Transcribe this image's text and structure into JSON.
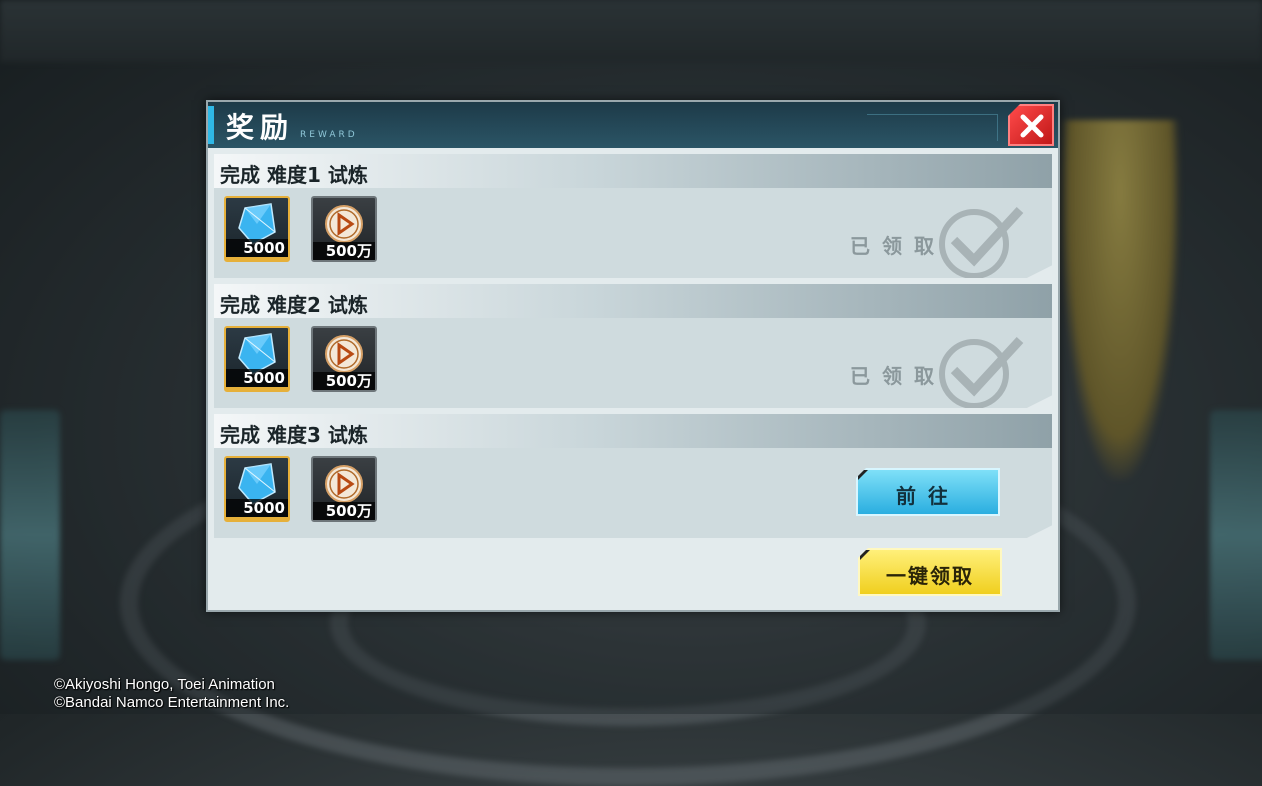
{
  "dialog": {
    "title": "奖励",
    "subtitle": "REWARD",
    "close_icon": "close-x-icon"
  },
  "rewards": [
    {
      "title": "完成 难度1 试炼",
      "items": [
        {
          "icon": "blue-crystal-icon",
          "count": "5000"
        },
        {
          "icon": "gold-coin-icon",
          "count": "500万"
        }
      ],
      "status": "claimed",
      "status_text": "已领取"
    },
    {
      "title": "完成 难度2 试炼",
      "items": [
        {
          "icon": "blue-crystal-icon",
          "count": "5000"
        },
        {
          "icon": "gold-coin-icon",
          "count": "500万"
        }
      ],
      "status": "claimed",
      "status_text": "已领取"
    },
    {
      "title": "完成 难度3 试炼",
      "items": [
        {
          "icon": "blue-crystal-icon",
          "count": "5000"
        },
        {
          "icon": "gold-coin-icon",
          "count": "500万"
        }
      ],
      "status": "go",
      "button_label": "前往"
    }
  ],
  "claim_all_label": "一键领取",
  "copyright": {
    "line1": "©Akiyoshi Hongo, Toei Animation",
    "line2": "©Bandai Namco Entertainment Inc."
  },
  "colors": {
    "accent_blue": "#2fb8e6",
    "close_red": "#e02020",
    "claim_yellow": "#f0cf1e",
    "crystal_border": "#e6b03a"
  }
}
